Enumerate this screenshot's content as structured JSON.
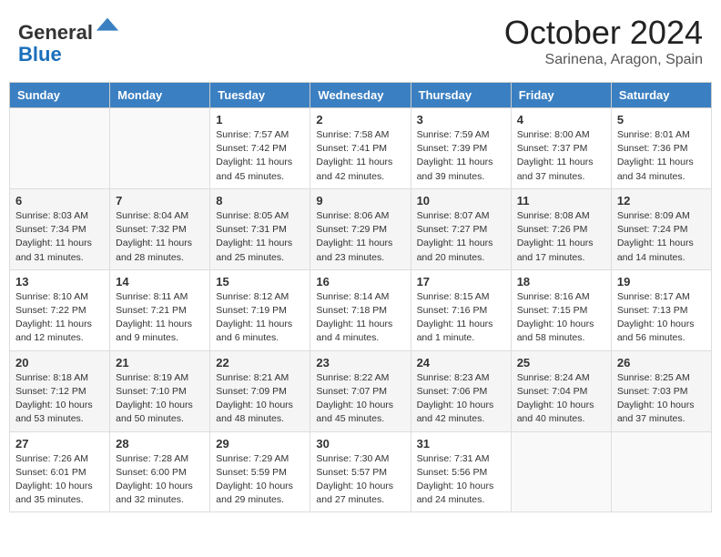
{
  "header": {
    "logo_line1": "General",
    "logo_line2": "Blue",
    "month": "October 2024",
    "location": "Sarinena, Aragon, Spain"
  },
  "weekdays": [
    "Sunday",
    "Monday",
    "Tuesday",
    "Wednesday",
    "Thursday",
    "Friday",
    "Saturday"
  ],
  "weeks": [
    [
      null,
      null,
      {
        "day": 1,
        "sunrise": "Sunrise: 7:57 AM",
        "sunset": "Sunset: 7:42 PM",
        "daylight": "Daylight: 11 hours and 45 minutes."
      },
      {
        "day": 2,
        "sunrise": "Sunrise: 7:58 AM",
        "sunset": "Sunset: 7:41 PM",
        "daylight": "Daylight: 11 hours and 42 minutes."
      },
      {
        "day": 3,
        "sunrise": "Sunrise: 7:59 AM",
        "sunset": "Sunset: 7:39 PM",
        "daylight": "Daylight: 11 hours and 39 minutes."
      },
      {
        "day": 4,
        "sunrise": "Sunrise: 8:00 AM",
        "sunset": "Sunset: 7:37 PM",
        "daylight": "Daylight: 11 hours and 37 minutes."
      },
      {
        "day": 5,
        "sunrise": "Sunrise: 8:01 AM",
        "sunset": "Sunset: 7:36 PM",
        "daylight": "Daylight: 11 hours and 34 minutes."
      }
    ],
    [
      {
        "day": 6,
        "sunrise": "Sunrise: 8:03 AM",
        "sunset": "Sunset: 7:34 PM",
        "daylight": "Daylight: 11 hours and 31 minutes."
      },
      {
        "day": 7,
        "sunrise": "Sunrise: 8:04 AM",
        "sunset": "Sunset: 7:32 PM",
        "daylight": "Daylight: 11 hours and 28 minutes."
      },
      {
        "day": 8,
        "sunrise": "Sunrise: 8:05 AM",
        "sunset": "Sunset: 7:31 PM",
        "daylight": "Daylight: 11 hours and 25 minutes."
      },
      {
        "day": 9,
        "sunrise": "Sunrise: 8:06 AM",
        "sunset": "Sunset: 7:29 PM",
        "daylight": "Daylight: 11 hours and 23 minutes."
      },
      {
        "day": 10,
        "sunrise": "Sunrise: 8:07 AM",
        "sunset": "Sunset: 7:27 PM",
        "daylight": "Daylight: 11 hours and 20 minutes."
      },
      {
        "day": 11,
        "sunrise": "Sunrise: 8:08 AM",
        "sunset": "Sunset: 7:26 PM",
        "daylight": "Daylight: 11 hours and 17 minutes."
      },
      {
        "day": 12,
        "sunrise": "Sunrise: 8:09 AM",
        "sunset": "Sunset: 7:24 PM",
        "daylight": "Daylight: 11 hours and 14 minutes."
      }
    ],
    [
      {
        "day": 13,
        "sunrise": "Sunrise: 8:10 AM",
        "sunset": "Sunset: 7:22 PM",
        "daylight": "Daylight: 11 hours and 12 minutes."
      },
      {
        "day": 14,
        "sunrise": "Sunrise: 8:11 AM",
        "sunset": "Sunset: 7:21 PM",
        "daylight": "Daylight: 11 hours and 9 minutes."
      },
      {
        "day": 15,
        "sunrise": "Sunrise: 8:12 AM",
        "sunset": "Sunset: 7:19 PM",
        "daylight": "Daylight: 11 hours and 6 minutes."
      },
      {
        "day": 16,
        "sunrise": "Sunrise: 8:14 AM",
        "sunset": "Sunset: 7:18 PM",
        "daylight": "Daylight: 11 hours and 4 minutes."
      },
      {
        "day": 17,
        "sunrise": "Sunrise: 8:15 AM",
        "sunset": "Sunset: 7:16 PM",
        "daylight": "Daylight: 11 hours and 1 minute."
      },
      {
        "day": 18,
        "sunrise": "Sunrise: 8:16 AM",
        "sunset": "Sunset: 7:15 PM",
        "daylight": "Daylight: 10 hours and 58 minutes."
      },
      {
        "day": 19,
        "sunrise": "Sunrise: 8:17 AM",
        "sunset": "Sunset: 7:13 PM",
        "daylight": "Daylight: 10 hours and 56 minutes."
      }
    ],
    [
      {
        "day": 20,
        "sunrise": "Sunrise: 8:18 AM",
        "sunset": "Sunset: 7:12 PM",
        "daylight": "Daylight: 10 hours and 53 minutes."
      },
      {
        "day": 21,
        "sunrise": "Sunrise: 8:19 AM",
        "sunset": "Sunset: 7:10 PM",
        "daylight": "Daylight: 10 hours and 50 minutes."
      },
      {
        "day": 22,
        "sunrise": "Sunrise: 8:21 AM",
        "sunset": "Sunset: 7:09 PM",
        "daylight": "Daylight: 10 hours and 48 minutes."
      },
      {
        "day": 23,
        "sunrise": "Sunrise: 8:22 AM",
        "sunset": "Sunset: 7:07 PM",
        "daylight": "Daylight: 10 hours and 45 minutes."
      },
      {
        "day": 24,
        "sunrise": "Sunrise: 8:23 AM",
        "sunset": "Sunset: 7:06 PM",
        "daylight": "Daylight: 10 hours and 42 minutes."
      },
      {
        "day": 25,
        "sunrise": "Sunrise: 8:24 AM",
        "sunset": "Sunset: 7:04 PM",
        "daylight": "Daylight: 10 hours and 40 minutes."
      },
      {
        "day": 26,
        "sunrise": "Sunrise: 8:25 AM",
        "sunset": "Sunset: 7:03 PM",
        "daylight": "Daylight: 10 hours and 37 minutes."
      }
    ],
    [
      {
        "day": 27,
        "sunrise": "Sunrise: 7:26 AM",
        "sunset": "Sunset: 6:01 PM",
        "daylight": "Daylight: 10 hours and 35 minutes."
      },
      {
        "day": 28,
        "sunrise": "Sunrise: 7:28 AM",
        "sunset": "Sunset: 6:00 PM",
        "daylight": "Daylight: 10 hours and 32 minutes."
      },
      {
        "day": 29,
        "sunrise": "Sunrise: 7:29 AM",
        "sunset": "Sunset: 5:59 PM",
        "daylight": "Daylight: 10 hours and 29 minutes."
      },
      {
        "day": 30,
        "sunrise": "Sunrise: 7:30 AM",
        "sunset": "Sunset: 5:57 PM",
        "daylight": "Daylight: 10 hours and 27 minutes."
      },
      {
        "day": 31,
        "sunrise": "Sunrise: 7:31 AM",
        "sunset": "Sunset: 5:56 PM",
        "daylight": "Daylight: 10 hours and 24 minutes."
      },
      null,
      null
    ]
  ]
}
